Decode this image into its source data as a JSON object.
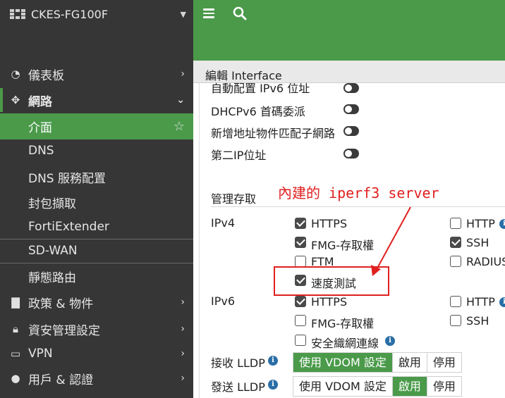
{
  "sidebar": {
    "brand": "CKES-FG100F",
    "items": [
      {
        "label": "儀表板",
        "icon": "dashboard-icon"
      },
      {
        "label": "網路",
        "icon": "network-icon"
      },
      {
        "label": "介面"
      },
      {
        "label": "DNS"
      },
      {
        "label": "DNS 服務配置"
      },
      {
        "label": "封包擷取"
      },
      {
        "label": "FortiExtender"
      },
      {
        "label": "SD-WAN"
      },
      {
        "label": "靜態路由"
      },
      {
        "label": "政策 & 物件",
        "icon": "policy-icon"
      },
      {
        "label": "資安管理設定",
        "icon": "lock-icon"
      },
      {
        "label": "VPN",
        "icon": "laptop-icon"
      },
      {
        "label": "用戶 & 認證",
        "icon": "user-icon"
      }
    ]
  },
  "header": {
    "breadcrumb": "編輯 Interface"
  },
  "form": {
    "toggles": [
      {
        "label": "自動配置 IPv6 位址"
      },
      {
        "label": "DHCPv6 首碼委派"
      },
      {
        "label": "新增地址物件匹配子網路"
      },
      {
        "label": "第二IP位址"
      }
    ],
    "access_title": "管理存取",
    "ipv4": {
      "label": "IPv4",
      "options": [
        {
          "label": "HTTPS",
          "checked": true
        },
        {
          "label": "FMG-存取權",
          "checked": true
        },
        {
          "label": "FTM",
          "checked": false
        },
        {
          "label": "速度測試",
          "checked": true
        },
        {
          "label": "HTTP",
          "checked": false
        },
        {
          "label": "SSH",
          "checked": true
        },
        {
          "label": "RADIUS",
          "checked": false
        }
      ]
    },
    "ipv6": {
      "label": "IPv6",
      "options": [
        {
          "label": "HTTPS",
          "checked": true
        },
        {
          "label": "FMG-存取權",
          "checked": false
        },
        {
          "label": "安全織網連線",
          "checked": false
        },
        {
          "label": "HTTP",
          "checked": false
        },
        {
          "label": "SSH",
          "checked": false
        }
      ]
    },
    "lldp_rx": {
      "label": "接收 LLDP",
      "options": [
        "使用 VDOM 設定",
        "啟用",
        "停用"
      ],
      "selected": "使用 VDOM 設定"
    },
    "lldp_tx": {
      "label": "發送 LLDP",
      "options": [
        "使用 VDOM 設定",
        "啟用",
        "停用"
      ],
      "selected": "啟用"
    }
  },
  "annotation": {
    "text": "內建的 iperf3 server"
  },
  "colors": {
    "accent": "#4a9a4a",
    "sidebar": "#363636",
    "annotation": "#e02020"
  }
}
